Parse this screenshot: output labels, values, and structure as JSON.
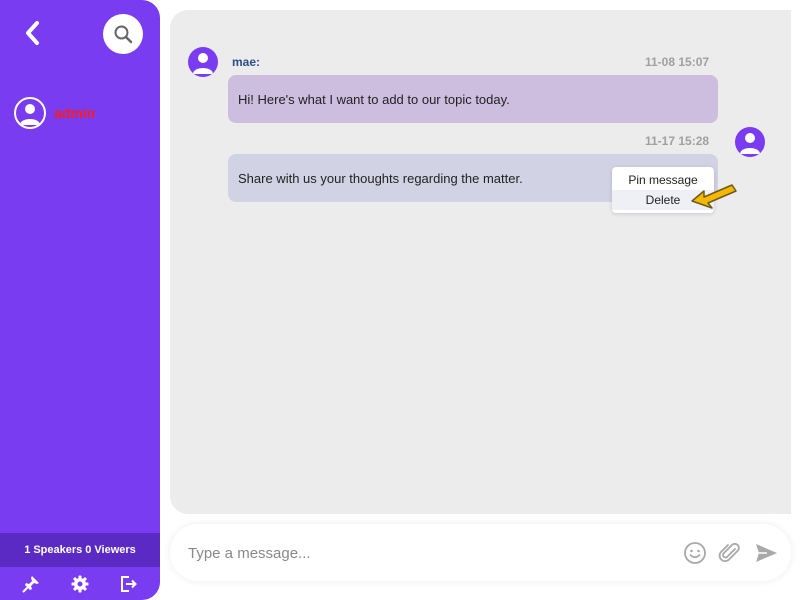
{
  "sidebar": {
    "user": {
      "name": "admin"
    },
    "stats": {
      "speakers_count": "1",
      "speakers_label": "Speakers",
      "viewers_count": "0",
      "viewers_label": "Viewers"
    }
  },
  "chat": {
    "messages": [
      {
        "sender": "mae:",
        "time": "11-08 15:07",
        "text": "Hi! Here's what I want to add to our topic today."
      },
      {
        "sender": "",
        "time": "11-17 15:28",
        "text": "Share with us your thoughts regarding the matter."
      }
    ],
    "context_menu": {
      "items": [
        "Pin message",
        "Delete"
      ]
    }
  },
  "composer": {
    "placeholder": "Type a message..."
  },
  "colors": {
    "sidebar": "#7a3cf0",
    "stats_bar": "#5b2ac4",
    "username": "#ff1a1a",
    "bubble_received": "#cdbedf",
    "bubble_sent": "#d1d3e4",
    "panel_bg": "#ececec",
    "cursor": "#f5b700"
  }
}
